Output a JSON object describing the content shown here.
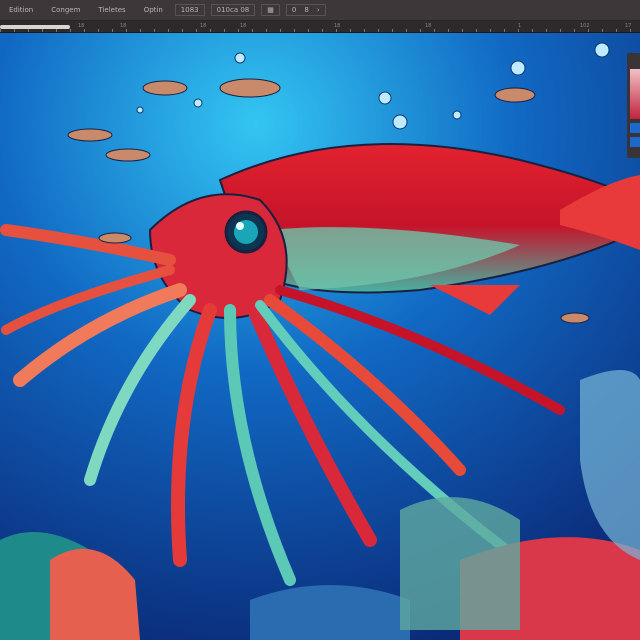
{
  "menu": {
    "items": [
      "Edition",
      "Congem",
      "Tieletes",
      "Optin"
    ],
    "size_field": "1083",
    "zoom_field": "010ca 08",
    "grid_btn": "▦",
    "nav_a": "0",
    "nav_b": "8",
    "nav_next": "›"
  },
  "ruler": {
    "labels": [
      "18",
      "18",
      "18",
      "18",
      "18",
      "18",
      "1",
      "102",
      "17"
    ]
  },
  "panel": {
    "colors": [
      "#f1c0c5",
      "#c2233d",
      "#1d68c8"
    ]
  },
  "progress": {
    "value": 1.0
  }
}
